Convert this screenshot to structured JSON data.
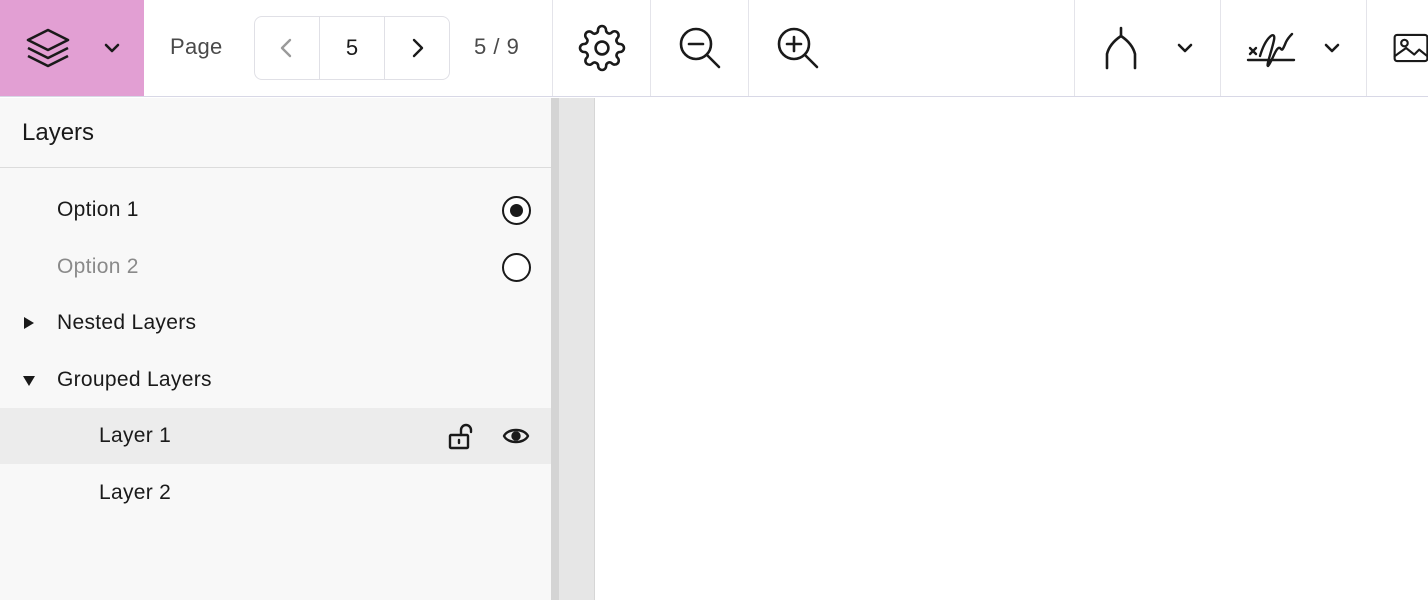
{
  "colors": {
    "accent": "#e29fd3",
    "icon": "#1a1a1a",
    "panel_bg": "#f8f8f8",
    "highlight_row": "#ececec",
    "canvas_bg": "#e6e6e6"
  },
  "toolbar": {
    "layers_button_icon": "layers-icon",
    "page_label": "Page",
    "current_page": "5",
    "page_count": "5 / 9",
    "tools": [
      {
        "name": "settings",
        "icon": "gear-icon"
      },
      {
        "name": "zoom-out",
        "icon": "zoom-out-icon"
      },
      {
        "name": "zoom-in",
        "icon": "zoom-in-icon"
      },
      {
        "name": "pen",
        "icon": "pen-nib-icon"
      },
      {
        "name": "signature",
        "icon": "signature-icon"
      },
      {
        "name": "image",
        "icon": "image-icon"
      }
    ]
  },
  "sidebar": {
    "title": "Layers",
    "items": [
      {
        "label": "Option 1",
        "type": "radio",
        "checked": true
      },
      {
        "label": "Option 2",
        "type": "radio",
        "checked": false,
        "disabled": true
      },
      {
        "label": "Nested Layers",
        "type": "group",
        "expanded": false
      },
      {
        "label": "Grouped Layers",
        "type": "group",
        "expanded": true
      },
      {
        "label": "Layer 1",
        "type": "layer",
        "locked": false,
        "visible": true,
        "highlighted": true
      },
      {
        "label": "Layer 2",
        "type": "layer"
      }
    ]
  }
}
